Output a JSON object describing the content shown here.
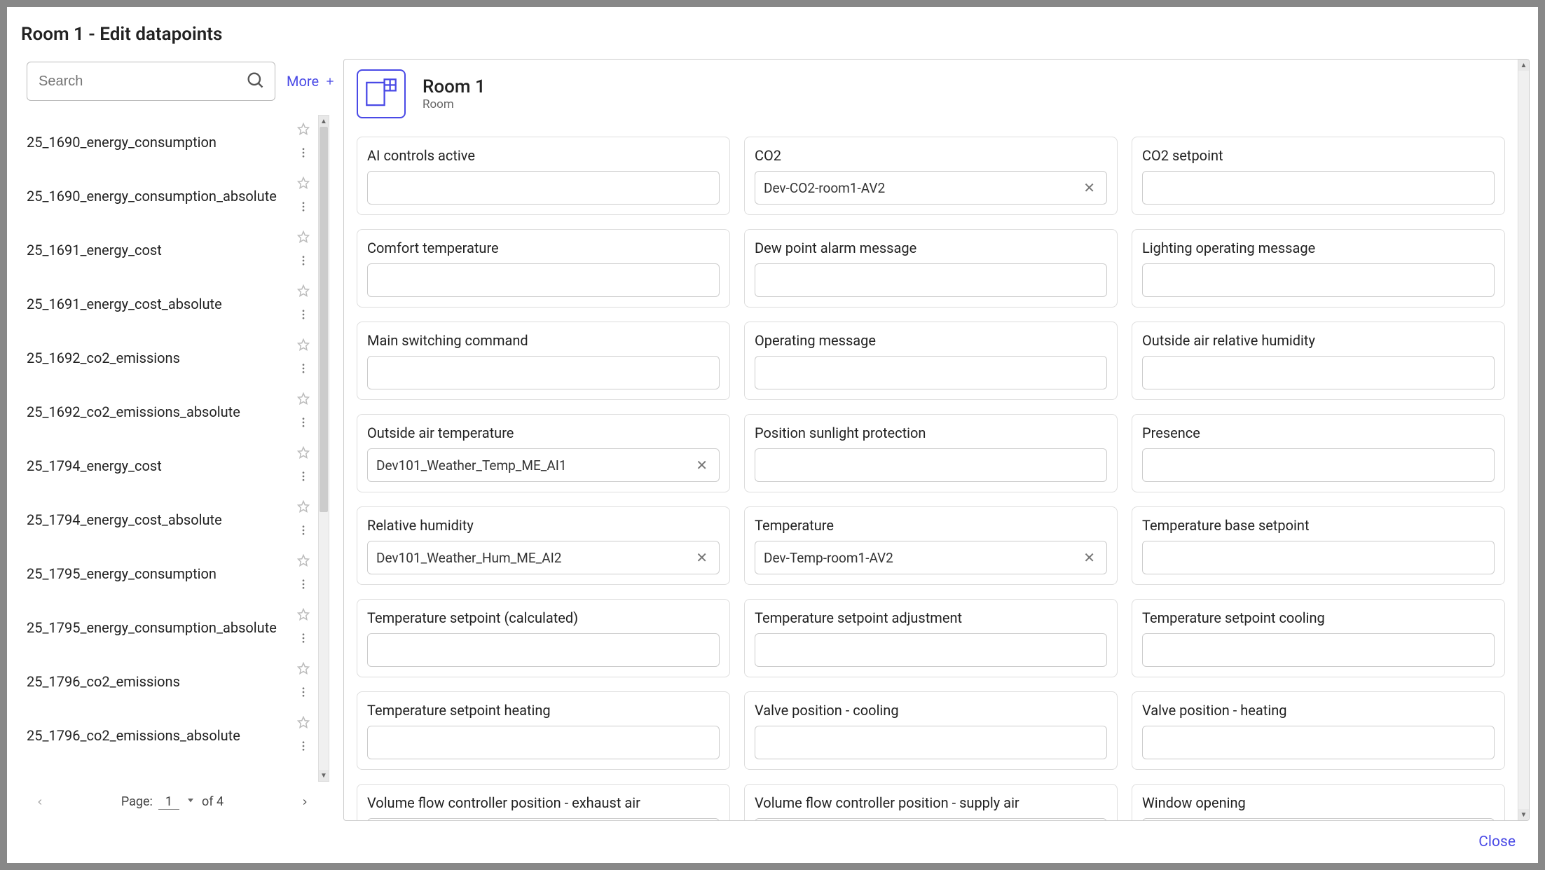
{
  "modal": {
    "title": "Room 1 - Edit datapoints",
    "close": "Close"
  },
  "sidebar": {
    "search_placeholder": "Search",
    "more_label": "More",
    "items": [
      "25_1690_energy_consumption",
      "25_1690_energy_consumption_absolute",
      "25_1691_energy_cost",
      "25_1691_energy_cost_absolute",
      "25_1692_co2_emissions",
      "25_1692_co2_emissions_absolute",
      "25_1794_energy_cost",
      "25_1794_energy_cost_absolute",
      "25_1795_energy_consumption",
      "25_1795_energy_consumption_absolute",
      "25_1796_co2_emissions",
      "25_1796_co2_emissions_absolute"
    ],
    "pagination": {
      "page_label": "Page:",
      "current": "1",
      "of_label": "of 4"
    }
  },
  "room": {
    "title": "Room 1",
    "subtitle": "Room"
  },
  "fields": [
    {
      "label": "AI controls active",
      "value": ""
    },
    {
      "label": "CO2",
      "value": "Dev-CO2-room1-AV2"
    },
    {
      "label": "CO2 setpoint",
      "value": ""
    },
    {
      "label": "Comfort temperature",
      "value": ""
    },
    {
      "label": "Dew point alarm message",
      "value": ""
    },
    {
      "label": "Lighting operating message",
      "value": ""
    },
    {
      "label": "Main switching command",
      "value": ""
    },
    {
      "label": "Operating message",
      "value": ""
    },
    {
      "label": "Outside air relative humidity",
      "value": ""
    },
    {
      "label": "Outside air temperature",
      "value": "Dev101_Weather_Temp_ME_AI1"
    },
    {
      "label": "Position sunlight protection",
      "value": ""
    },
    {
      "label": "Presence",
      "value": ""
    },
    {
      "label": "Relative humidity",
      "value": "Dev101_Weather_Hum_ME_AI2"
    },
    {
      "label": "Temperature",
      "value": "Dev-Temp-room1-AV2"
    },
    {
      "label": "Temperature base setpoint",
      "value": ""
    },
    {
      "label": "Temperature setpoint (calculated)",
      "value": ""
    },
    {
      "label": "Temperature setpoint adjustment",
      "value": ""
    },
    {
      "label": "Temperature setpoint cooling",
      "value": ""
    },
    {
      "label": "Temperature setpoint heating",
      "value": ""
    },
    {
      "label": "Valve position - cooling",
      "value": ""
    },
    {
      "label": "Valve position - heating",
      "value": ""
    },
    {
      "label": "Volume flow controller position - exhaust air",
      "value": ""
    },
    {
      "label": "Volume flow controller position - supply air",
      "value": ""
    },
    {
      "label": "Window opening",
      "value": ""
    }
  ]
}
